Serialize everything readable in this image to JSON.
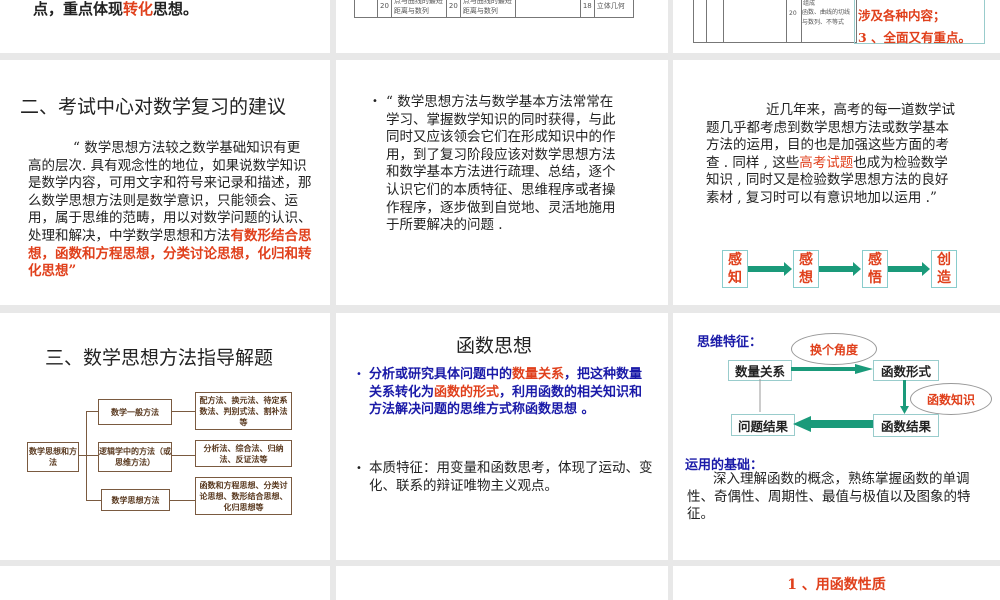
{
  "slides": {
    "top_left": {
      "text_a": "点，重点体现",
      "text_red": "转化",
      "text_b": "思想。"
    },
    "top_mid": {
      "row": [
        {
          "num": "20",
          "text": "点与曲线的最短距离与数列"
        },
        {
          "num": "20",
          "text": "点与曲线的最短距离与数列"
        },
        {
          "num": "18",
          "text": "立体几何"
        }
      ]
    },
    "top_right": {
      "num": "20",
      "cell_a": "组成",
      "cell_b": "函数、曲线的切线与数列、不等式",
      "note_line1": "涉及各种内容；",
      "note_line2": "3 、全面又有重点。"
    },
    "s2": {
      "title": "二、考试中心对数学复习的建议",
      "body": "“ 数学思想方法较之数学基础知识有更高的层次. 具有观念性的地位，如果说数学知识是数学内容，可用文字和符号来记录和描述，那么数学思想方法则是数学意识，只能领会、运用，属于思维的范畴，用以对数学问题的认识、处理和解决，中学数学思想和方法",
      "body_red": "有数形结合思想，函数和方程思想，分类讨论思想，化归和转化思想”"
    },
    "s3": {
      "bullet": "“ 数学思想方法与数学基本方法常常在学习、掌握数学知识的同时获得，与此同时又应该领会它们在形成知识中的作用，到了复习阶段应该对数学思想方法和数学基本方法进行疏理、总结，逐个认识它们的本质特征、思维程序或者操作程序，逐步做到自觉地、灵活地施用于所要解决的问题 ."
    },
    "s4": {
      "text_a": "近几年来，高考的每一道数学试题几乎都考虑到数学思想方法或数学基本方法的运用，目的也是加强这些方面的考查 . 同样 , 这些",
      "text_red": "高考试题",
      "text_b": "也成为检验数学知识 , 同时又是检验数学思想方法的良好素材 , 复习时可以有意识地加以运用 .”",
      "flow": [
        "感知",
        "感想",
        "感悟",
        "创造"
      ]
    },
    "s5": {
      "title": "三、数学思想方法指导解题",
      "root": "数学思想和方法",
      "branches": [
        {
          "label": "数学一般方法",
          "detail": "配方法、换元法、待定系数法、判别式法、割补法等"
        },
        {
          "label": "逻辑学中的方法（或思维方法）",
          "detail": "分析法、综合法、归纳法、反证法等"
        },
        {
          "label": "数学思想方法",
          "detail": "函数和方程思想、分类讨论思想、数形结合思想、化归思想等"
        }
      ]
    },
    "s6": {
      "title": "函数思想",
      "b1_a": "分析或研究具体问题中的",
      "b1_red1": "数量关系",
      "b1_b": "，把这种数量关系转化为",
      "b1_red2": "函数的形式",
      "b1_c": "，利用函数的相关知识和方法解决问题的思维方式称函数思想 。",
      "b2": "本质特征：用变量和函数思考，体现了运动、变化、联系的辩证唯物主义观点。"
    },
    "s7": {
      "heading": "思维特征：",
      "ellipse1": "换个角度",
      "ellipse2": "函数知识",
      "box1": "数量关系",
      "box2": "函数形式",
      "box3": "函数结果",
      "box4": "问题结果",
      "basis_heading": "运用的基础：",
      "basis": "深入理解函数的概念，熟练掌握函数的单调性、奇偶性、周期性、最值与极值以及图象的特征。"
    },
    "s10": {
      "title": "1 、用函数性质"
    }
  }
}
